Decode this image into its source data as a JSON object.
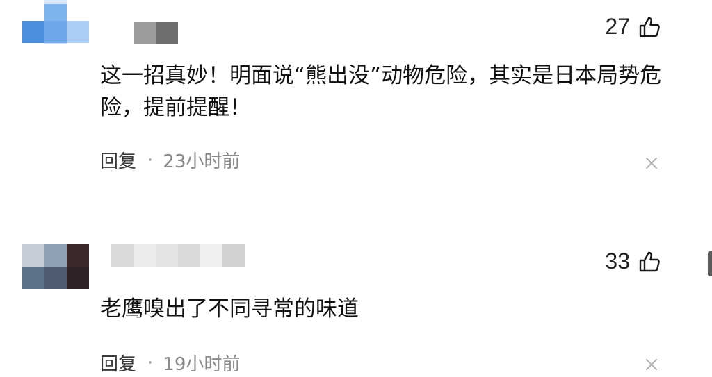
{
  "comments": [
    {
      "like_count": "27",
      "text": "这一招真妙！明面说“熊出没”动物危险，其实是日本局势危险，提前提醒！",
      "reply_label": "回复",
      "separator": "·",
      "time": "23小时前"
    },
    {
      "like_count": "33",
      "text": "老鹰嗅出了不同寻常的味道",
      "reply_label": "回复",
      "separator": "·",
      "time": "19小时前"
    }
  ],
  "icons": {
    "like": "thumbs-up-icon",
    "close": "close-icon"
  },
  "colors": {
    "text": "#111111",
    "meta": "#8a8a8a",
    "avatar1_light": "#a9cdf3",
    "avatar1_dark": "#4a8fe0",
    "avatar2_dark": "#3a2a2c",
    "avatar2_blue": "#5d7389"
  }
}
